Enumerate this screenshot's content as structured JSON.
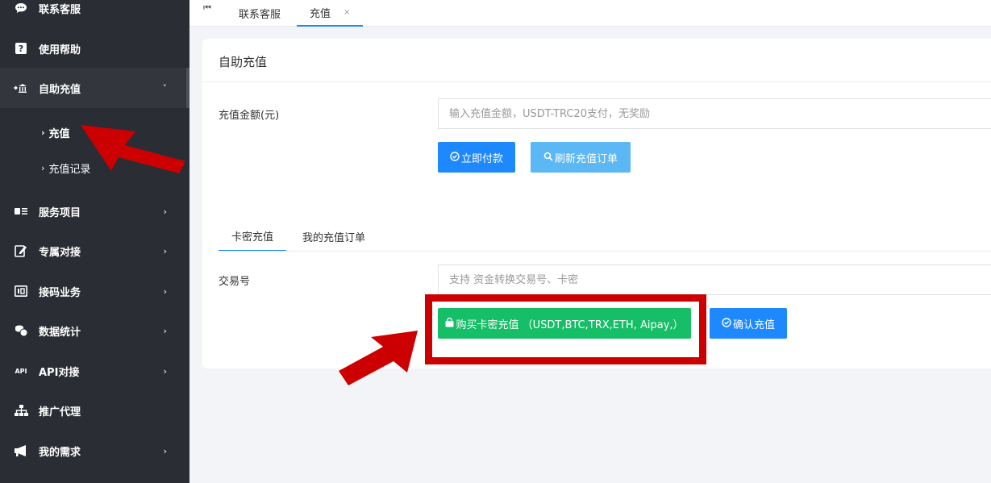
{
  "sidebar": {
    "items": [
      {
        "label": "联系客服",
        "icon": "chat-icon",
        "chevron": ""
      },
      {
        "label": "使用帮助",
        "icon": "help-icon",
        "chevron": ""
      },
      {
        "label": "自助充值",
        "icon": "bank-icon",
        "chevron": "˅"
      },
      {
        "label": "服务项目",
        "icon": "service-icon",
        "chevron": "›"
      },
      {
        "label": "专属对接",
        "icon": "edit-icon",
        "chevron": "›"
      },
      {
        "label": "接码业务",
        "icon": "code-icon",
        "chevron": "›"
      },
      {
        "label": "数据统计",
        "icon": "coins-icon",
        "chevron": "›"
      },
      {
        "label": "API对接",
        "icon": "api-icon",
        "chevron": "›"
      },
      {
        "label": "推广代理",
        "icon": "sitemap-icon",
        "chevron": ""
      },
      {
        "label": "我的需求",
        "icon": "megaphone-icon",
        "chevron": "›"
      }
    ],
    "subitems": [
      {
        "label": "充值",
        "arrow": "›"
      },
      {
        "label": "充值记录",
        "arrow": "›"
      }
    ],
    "api_icon_text": "API"
  },
  "tabs": {
    "first_icon": "⏮",
    "items": [
      {
        "label": "联系客服"
      },
      {
        "label": "充值",
        "close": "×"
      }
    ]
  },
  "card": {
    "title": "自助充值",
    "amount_label": "充值金额(元)",
    "amount_placeholder": "输入充值金额，USDT-TRC20支付，无奖励",
    "pay_button": "立即付款",
    "refresh_button": "刷新充值订单",
    "subtabs": [
      "卡密充值",
      "我的充值订单"
    ],
    "txn_label": "交易号",
    "txn_placeholder": "支持 资金转换交易号、卡密",
    "buy_button": "购买卡密充值 （USDT,BTC,TRX,ETH, Aipay,）",
    "confirm_button": "确认充值"
  },
  "colors": {
    "sidebar_bg": "#2a2d34",
    "primary_blue": "#1e88ff",
    "light_blue": "#5bb8f5",
    "green": "#16be67",
    "annotation_red": "#cc0000"
  }
}
